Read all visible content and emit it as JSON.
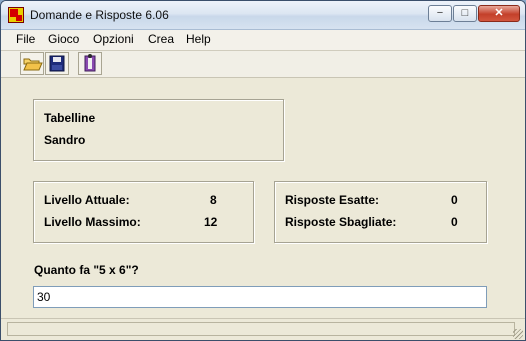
{
  "window": {
    "title": "Domande e Risposte 6.06",
    "minimize_label": "−",
    "maximize_label": "□",
    "close_label": "✕"
  },
  "menu": [
    {
      "label": "File"
    },
    {
      "label": "Gioco"
    },
    {
      "label": "Opzioni"
    },
    {
      "label": "Crea"
    },
    {
      "label": "Help"
    }
  ],
  "toolbar": {
    "icons": [
      "open-folder-icon",
      "save-disk-icon",
      "exit-door-icon"
    ]
  },
  "info": {
    "topic": "Tabelline",
    "player": "Sandro"
  },
  "levels": {
    "current_label": "Livello Attuale:",
    "current_value": "8",
    "max_label": "Livello Massimo:",
    "max_value": "12"
  },
  "answers": {
    "correct_label": "Risposte Esatte:",
    "correct_value": "0",
    "wrong_label": "Risposte Sbagliate:",
    "wrong_value": "0"
  },
  "question": {
    "text": "Quanto fa \"5 x 6\"?",
    "answer_value": "30"
  },
  "colors": {
    "titlebar": "#dce6f2",
    "close": "#c4402a",
    "window": "#ece9d8",
    "app_icon_yellow": "#e8d000",
    "app_icon_red": "#d40000"
  }
}
